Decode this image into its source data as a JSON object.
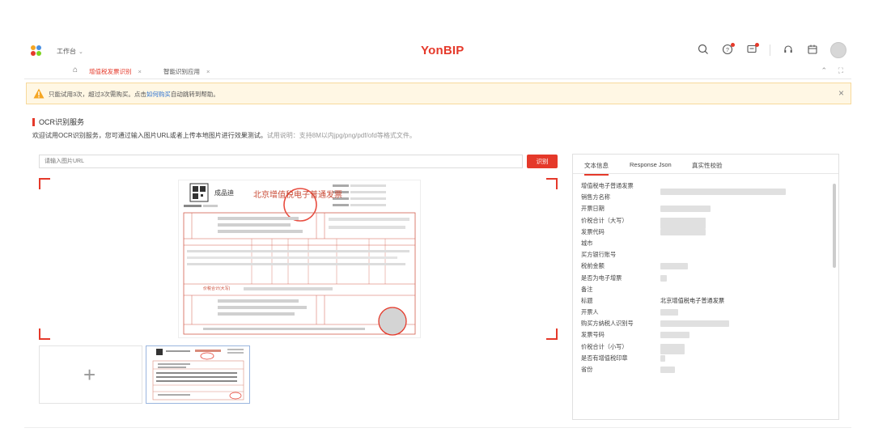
{
  "header": {
    "workspace_label": "工作台",
    "brand": "YonBIP"
  },
  "tabs": [
    {
      "label": "增值税发票识别",
      "active": true
    },
    {
      "label": "智能识别应用",
      "active": false
    }
  ],
  "alert": {
    "text_before": "只能试用3次，超过3次需购买。点击",
    "link": "如何购买",
    "text_after": "自动跳转到帮助。"
  },
  "section": {
    "title": "OCR识别服务",
    "description": "欢迎试用OCR识别服务，您可通过输入图片URL或者上传本地图片进行效果测试。",
    "note": "试用说明：支持8M以内jpg/png/pdf/ofd等格式文件。"
  },
  "url_input": {
    "placeholder": "请输入图片URL"
  },
  "recognize_button": "识别",
  "invoice": {
    "seller_name": "成品迪",
    "title": "北京增值税电子普通发票",
    "total_label": "价税合计(大写)"
  },
  "panel": {
    "tabs": [
      "文本信息",
      "Response Json",
      "真实性校验"
    ],
    "fields": [
      {
        "label": "增值税电子普通发票",
        "value": ""
      },
      {
        "label": "销售方名称",
        "value": ""
      },
      {
        "label": "开票日期",
        "value": ""
      },
      {
        "label": "价税合计（大写）",
        "value": ""
      },
      {
        "label": "发票代码",
        "value": ""
      },
      {
        "label": "城市",
        "value": ""
      },
      {
        "label": "买方银行账号",
        "value": ""
      },
      {
        "label": "税前金额",
        "value": ""
      },
      {
        "label": "是否为电子增票",
        "value": ""
      },
      {
        "label": "备注",
        "value": ""
      },
      {
        "label": "标题",
        "value": "北京增值税电子普通发票"
      },
      {
        "label": "开票人",
        "value": ""
      },
      {
        "label": "购买方纳税人识别号",
        "value": ""
      },
      {
        "label": "发票号码",
        "value": ""
      },
      {
        "label": "价税合计（小写）",
        "value": ""
      },
      {
        "label": "是否有增值税印章",
        "value": ""
      },
      {
        "label": "省份",
        "value": ""
      }
    ]
  },
  "colors": {
    "accent": "#e5392a",
    "alert_bg": "#fff7e4",
    "link": "#2f74d0"
  }
}
